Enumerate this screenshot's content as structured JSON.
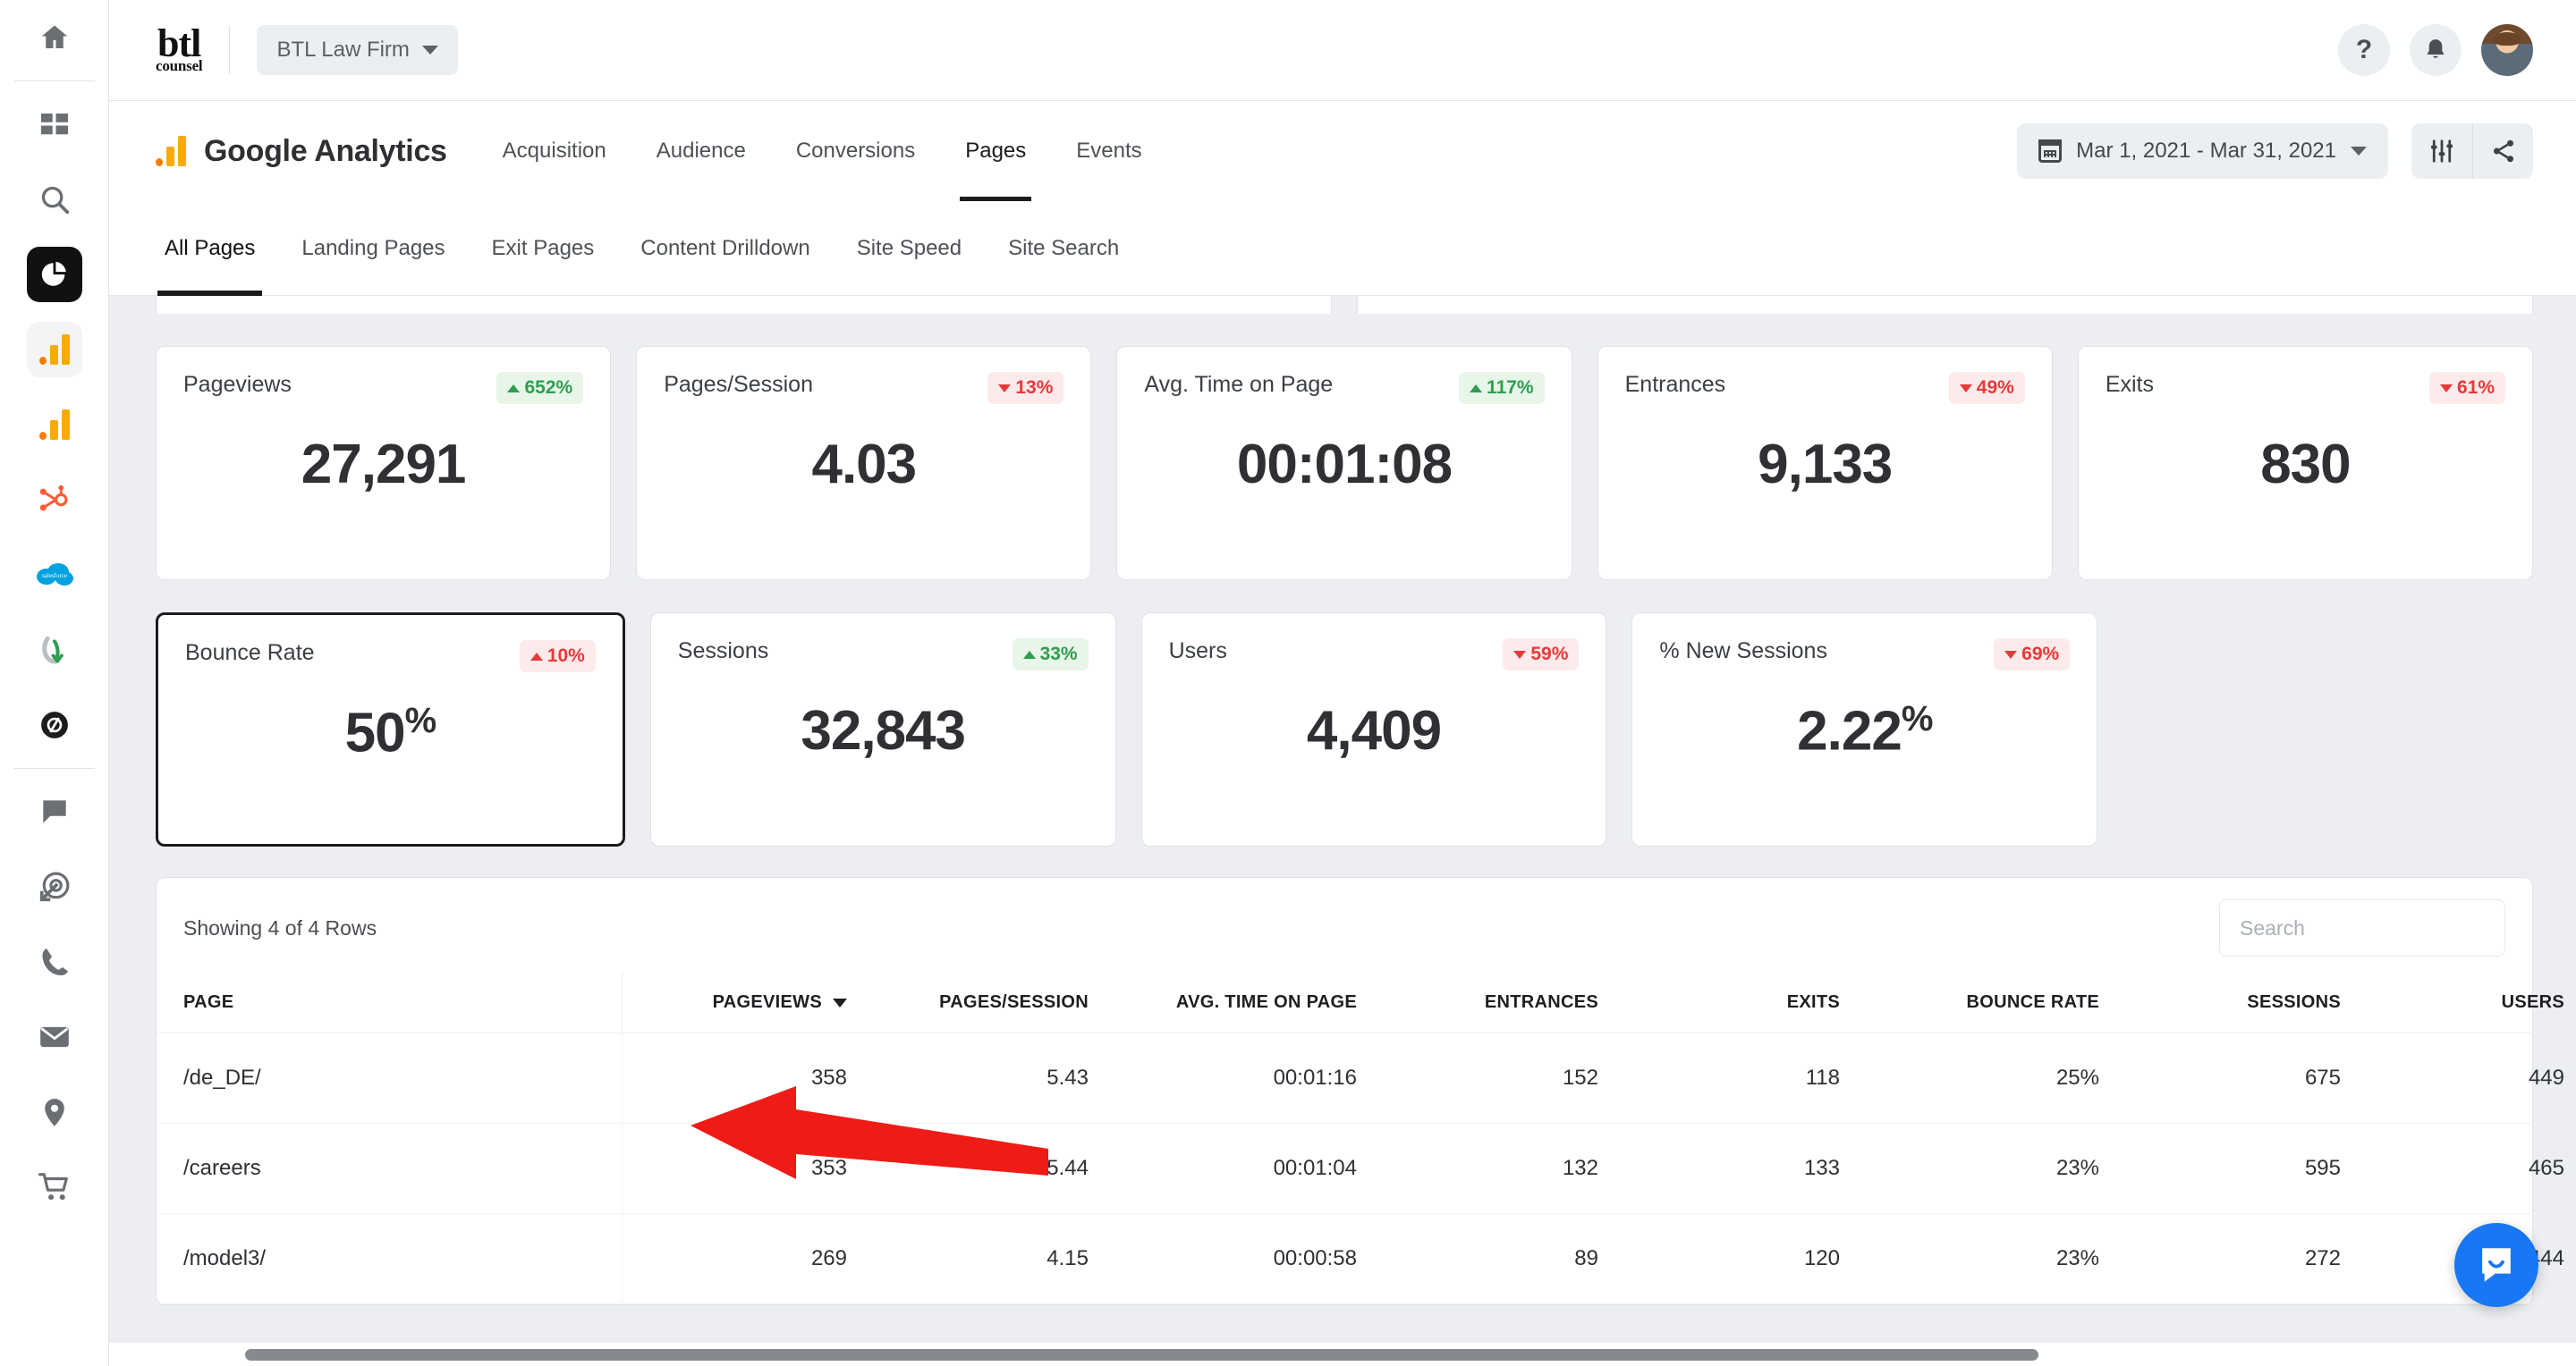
{
  "rail": {
    "items": [
      {
        "name": "home",
        "icon": "home-icon"
      },
      {
        "name": "dashboard",
        "icon": "grid-icon"
      },
      {
        "name": "search",
        "icon": "search-icon"
      },
      {
        "name": "reports",
        "icon": "pie-chart-icon",
        "active": true
      },
      {
        "name": "google-analytics",
        "icon": "google-analytics-icon",
        "selected": true
      },
      {
        "name": "google-analytics-2",
        "icon": "google-analytics-icon"
      },
      {
        "name": "hubspot",
        "icon": "hubspot-icon"
      },
      {
        "name": "salesforce",
        "icon": "salesforce-icon"
      },
      {
        "name": "mailchimp",
        "icon": "mailchimp-icon"
      },
      {
        "name": "zendesk",
        "icon": "zendesk-icon"
      },
      {
        "name": "chat",
        "icon": "chat-bubble-icon"
      },
      {
        "name": "targeting",
        "icon": "target-arrow-icon"
      },
      {
        "name": "calls",
        "icon": "phone-icon"
      },
      {
        "name": "email",
        "icon": "envelope-icon"
      },
      {
        "name": "locations",
        "icon": "map-pin-icon"
      },
      {
        "name": "ecommerce",
        "icon": "shopping-cart-icon"
      }
    ]
  },
  "topbar": {
    "logo_line1": "btl",
    "logo_line2": "counsel",
    "account": "BTL Law Firm",
    "help_glyph": "?",
    "help_label": "Help",
    "notifications_label": "Notifications",
    "avatar_label": "User profile"
  },
  "analytics": {
    "title": "Google Analytics",
    "tabs": [
      {
        "label": "Acquisition",
        "active": false
      },
      {
        "label": "Audience",
        "active": false
      },
      {
        "label": "Conversions",
        "active": false
      },
      {
        "label": "Pages",
        "active": true
      },
      {
        "label": "Events",
        "active": false
      }
    ],
    "date_range": "Mar 1, 2021 - Mar 31, 2021",
    "filter_label": "Filters",
    "share_label": "Share"
  },
  "subtabs": [
    {
      "label": "All Pages",
      "active": true
    },
    {
      "label": "Landing Pages",
      "active": false
    },
    {
      "label": "Exit Pages",
      "active": false
    },
    {
      "label": "Content Drilldown",
      "active": false
    },
    {
      "label": "Site Speed",
      "active": false
    },
    {
      "label": "Site Search",
      "active": false
    }
  ],
  "metric_cards": [
    {
      "label": "Pageviews",
      "value": "27,291",
      "suffix": "",
      "delta": "652%",
      "dir": "up",
      "tone": "good",
      "selected": false
    },
    {
      "label": "Pages/Session",
      "value": "4.03",
      "suffix": "",
      "delta": "13%",
      "dir": "down",
      "tone": "bad",
      "selected": false
    },
    {
      "label": "Avg. Time on Page",
      "value": "00:01:08",
      "suffix": "",
      "delta": "117%",
      "dir": "up",
      "tone": "good",
      "selected": false
    },
    {
      "label": "Entrances",
      "value": "9,133",
      "suffix": "",
      "delta": "49%",
      "dir": "down",
      "tone": "bad",
      "selected": false
    },
    {
      "label": "Exits",
      "value": "830",
      "suffix": "",
      "delta": "61%",
      "dir": "down",
      "tone": "bad",
      "selected": false
    },
    {
      "label": "Bounce Rate",
      "value": "50",
      "suffix": "%",
      "delta": "10%",
      "dir": "up",
      "tone": "bad",
      "selected": true
    },
    {
      "label": "Sessions",
      "value": "32,843",
      "suffix": "",
      "delta": "33%",
      "dir": "up",
      "tone": "good",
      "selected": false
    },
    {
      "label": "Users",
      "value": "4,409",
      "suffix": "",
      "delta": "59%",
      "dir": "down",
      "tone": "bad",
      "selected": false
    },
    {
      "label": "% New Sessions",
      "value": "2.22",
      "suffix": "%",
      "delta": "69%",
      "dir": "down",
      "tone": "bad",
      "selected": false
    }
  ],
  "table": {
    "rows_label": "Showing 4 of 4 Rows",
    "search_placeholder": "Search",
    "sorted_column": "PAGEVIEWS",
    "sort_direction": "desc",
    "columns": [
      "PAGE",
      "PAGEVIEWS",
      "PAGES/SESSION",
      "AVG. TIME ON PAGE",
      "ENTRANCES",
      "EXITS",
      "BOUNCE RATE",
      "SESSIONS",
      "USERS"
    ],
    "rows": [
      {
        "page": "/de_DE/",
        "pageviews": "358",
        "pages_session": "5.43",
        "avg_time": "00:01:16",
        "entrances": "152",
        "exits": "118",
        "bounce_rate": "25%",
        "sessions": "675",
        "users": "449"
      },
      {
        "page": "/careers",
        "pageviews": "353",
        "pages_session": "5.44",
        "avg_time": "00:01:04",
        "entrances": "132",
        "exits": "133",
        "bounce_rate": "23%",
        "sessions": "595",
        "users": "465"
      },
      {
        "page": "/model3/",
        "pageviews": "269",
        "pages_session": "4.15",
        "avg_time": "00:00:58",
        "entrances": "89",
        "exits": "120",
        "bounce_rate": "23%",
        "sessions": "272",
        "users": "444"
      }
    ]
  },
  "annotation": {
    "arrow_label": "red arrow pointing at Bounce Rate card",
    "arrow_color": "#ee1b17"
  },
  "colors": {
    "accent_green": "#2e9e4f",
    "accent_red": "#e8393a",
    "page_bg": "#eceef1",
    "card_bg": "#ffffff",
    "intercom_blue": "#1877f2",
    "selected_border": "#1b1c1e"
  },
  "intercom": {
    "label": "Open messenger"
  }
}
